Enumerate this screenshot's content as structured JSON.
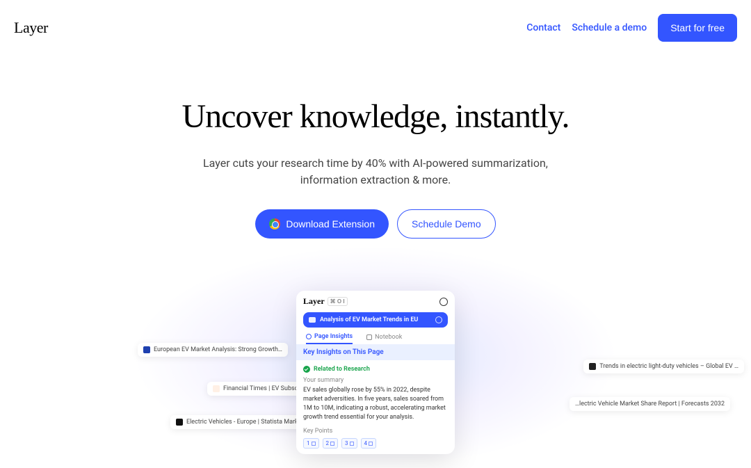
{
  "header": {
    "logo": "Layer",
    "nav": {
      "contact": "Contact",
      "schedule": "Schedule a demo",
      "cta": "Start for free"
    }
  },
  "hero": {
    "title": "Uncover knowledge, instantly.",
    "subtitle": "Layer cuts your research time by 40% with AI-powered summarization, information extraction & more.",
    "download_btn": "Download Extension",
    "demo_btn": "Schedule Demo"
  },
  "panel": {
    "logo": "Layer",
    "shortcut": "⌘ O I",
    "search_query": "Analysis of EV Market Trends in EU",
    "tab_insights": "Page Insights",
    "tab_notebook": "Notebook",
    "highlight": "Key Insights on This Page",
    "related": "Related to Research",
    "summary_label": "Your summary",
    "summary_text": "EV sales globally rose by 55% in 2022, despite market adversities. In five years, sales soared from 1M to 10M, indicating a robust, accelerating market growth trend essential for your analysis.",
    "keypoints_label": "Key Points",
    "kp": [
      "1",
      "2",
      "3",
      "4"
    ]
  },
  "chips": {
    "c1": "European EV Market Analysis: Strong Growth…",
    "c2": "Financial Times | EV Subscripti…",
    "c3": "Electric Vehicles - Europe | Statista Market For…",
    "c4": "Trends in electric light-duty vehicles – Global EV …",
    "c5": "…lectric Vehicle Market Share Report | Forecasts 2032"
  }
}
